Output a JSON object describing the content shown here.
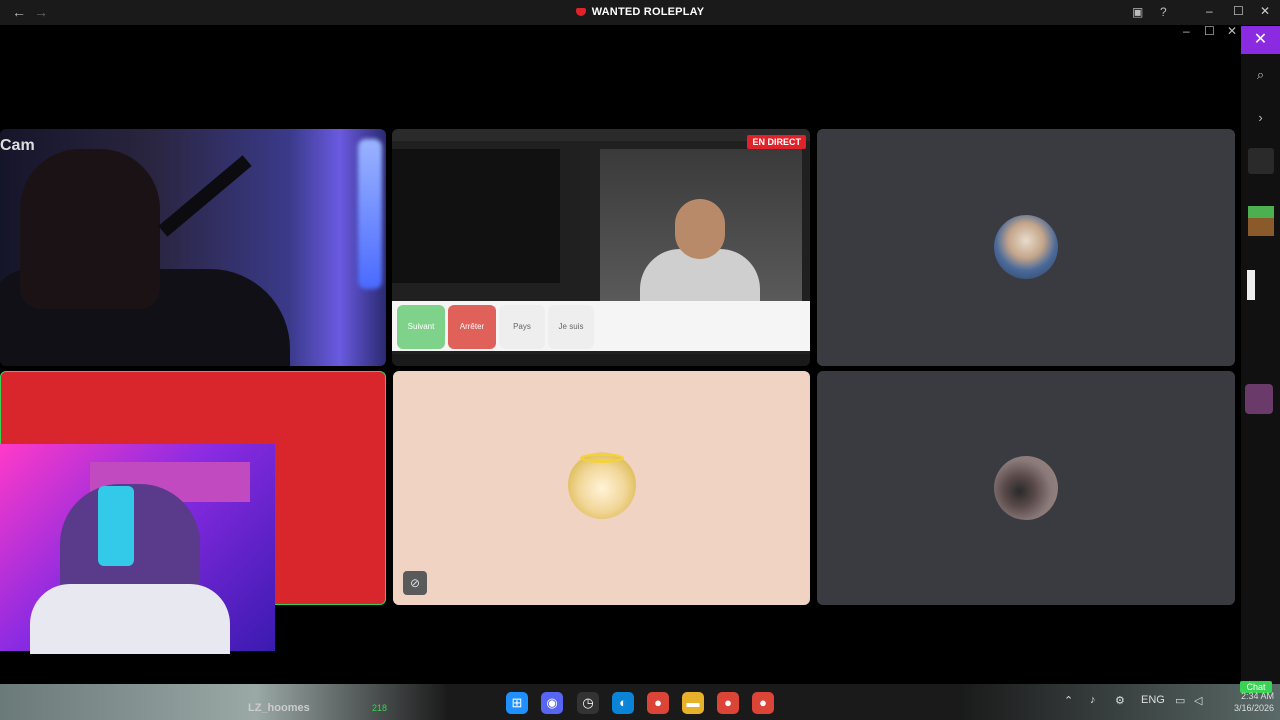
{
  "app": {
    "title": "WANTED ROLEPLAY"
  },
  "titlebar": {
    "back_icon": "back-arrow-icon",
    "forward_icon": "forward-arrow-icon"
  },
  "tiles": {
    "cam": {
      "label": "Cam"
    },
    "live": {
      "badge": "EN DIRECT",
      "buttons": [
        "Suivant",
        "Arrêter",
        "Pays",
        "Je suis"
      ]
    }
  },
  "taskbar": {
    "user": "LZ_hoomes",
    "count": "218",
    "language": "ENG",
    "time": "2:34 AM",
    "date": "3/16/2026",
    "chat_label": "Chat"
  },
  "colors": {
    "live_red": "#e0232a",
    "active_green": "#39d353",
    "panel_purple": "#8a2be2"
  }
}
